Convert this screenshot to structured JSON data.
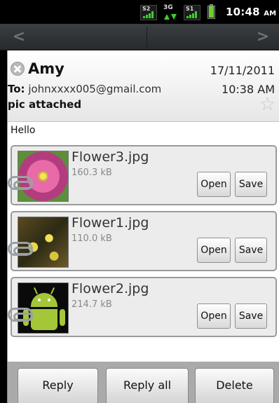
{
  "status_bar": {
    "signal_1_label": "S2",
    "data_label": "3G",
    "signal_2_label": "S1",
    "time": "10:48",
    "ampm": "AM",
    "battery_level_percent": 95
  },
  "nav": {
    "prev_glyph": "<",
    "next_glyph": ">"
  },
  "message": {
    "sender": "Amy",
    "date": "17/11/2011",
    "to_label": "To:",
    "to_address": "johnxxxx005@gmail.com",
    "time": "10:38 AM",
    "subject": "pic attached",
    "body": "Hello"
  },
  "attachments": [
    {
      "name": "Flower3.jpg",
      "size": "160.3 kB",
      "open_label": "Open",
      "save_label": "Save"
    },
    {
      "name": "Flower1.jpg",
      "size": "110.0 kB",
      "open_label": "Open",
      "save_label": "Save"
    },
    {
      "name": "Flower2.jpg",
      "size": "214.7 kB",
      "open_label": "Open",
      "save_label": "Save"
    }
  ],
  "actions": {
    "reply": "Reply",
    "reply_all": "Reply all",
    "delete": "Delete"
  },
  "icons": {
    "star": "☆",
    "presence": "presence-offline-icon"
  },
  "colors": {
    "signal_green": "#3ccf2e",
    "android_green": "#a4c639"
  }
}
